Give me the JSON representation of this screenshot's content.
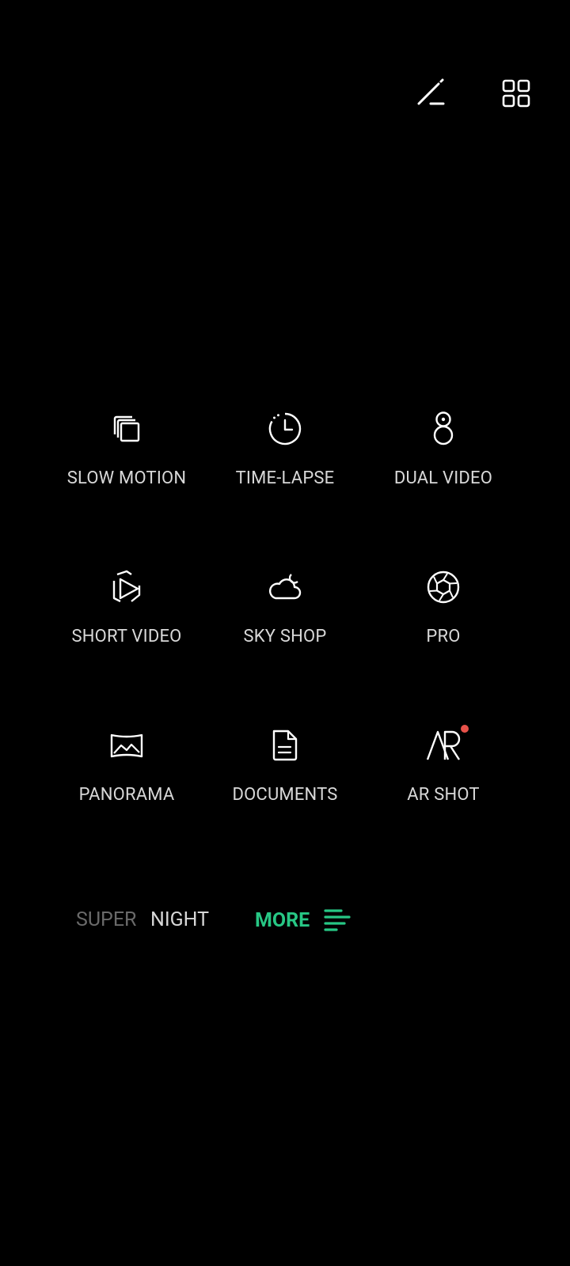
{
  "top_bar": {
    "edit_icon": "edit-pen-icon",
    "grid_icon": "grid-icon"
  },
  "modes": [
    {
      "label": "SLOW MOTION",
      "icon": "slow-motion-icon"
    },
    {
      "label": "TIME-LAPSE",
      "icon": "time-lapse-icon"
    },
    {
      "label": "DUAL VIDEO",
      "icon": "dual-video-icon"
    },
    {
      "label": "SHORT VIDEO",
      "icon": "short-video-icon"
    },
    {
      "label": "SKY SHOP",
      "icon": "sky-shop-icon"
    },
    {
      "label": "PRO",
      "icon": "pro-aperture-icon"
    },
    {
      "label": "PANORAMA",
      "icon": "panorama-icon"
    },
    {
      "label": "DOCUMENTS",
      "icon": "document-icon"
    },
    {
      "label": "AR SHOT",
      "icon": "ar-icon",
      "badge": "new-dot"
    }
  ],
  "strip": {
    "super": "SUPER",
    "night": "NIGHT",
    "more": "MORE",
    "more_icon": "menu-lines-icon"
  },
  "colors": {
    "background": "#000000",
    "accent_green": "#27c785",
    "badge_red": "#e8524a",
    "text_primary": "#d8d8d8",
    "text_muted": "#6a6a6a"
  }
}
